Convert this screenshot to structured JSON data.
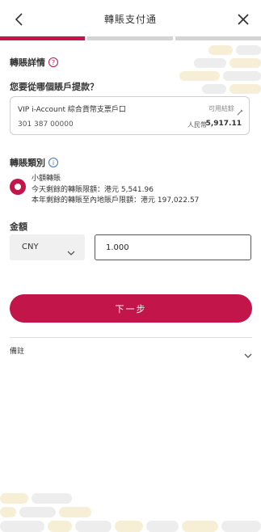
{
  "header": {
    "title": "轉賬支付通",
    "back_icon": "back-chevron-icon",
    "close_icon": "close-icon"
  },
  "progress": {
    "current_step": 1,
    "total_steps": 3,
    "accent": "#c2164b"
  },
  "details": {
    "label": "轉賬詳情",
    "question": "您要從哪個賬戶提款？"
  },
  "account": {
    "name": "VIP i-Account 綜合貨幣支票戶口",
    "number": "301 387 00000",
    "available_label": "可用結餘",
    "currency": "人民幣",
    "balance": "5,917.11"
  },
  "transfer_type": {
    "label": "轉賬類別",
    "option_title": "小額轉賬",
    "limit_today": "今天剩餘的轉賬限額：港元 5,541.96",
    "limit_year": "本年剩餘的轉賬至內地賬戶限額：港元 197,022.57"
  },
  "amount": {
    "label": "金額",
    "currency": "CNY",
    "value": "1.000"
  },
  "actions": {
    "next_label": "下一步"
  },
  "remarks": {
    "label": "備註"
  }
}
